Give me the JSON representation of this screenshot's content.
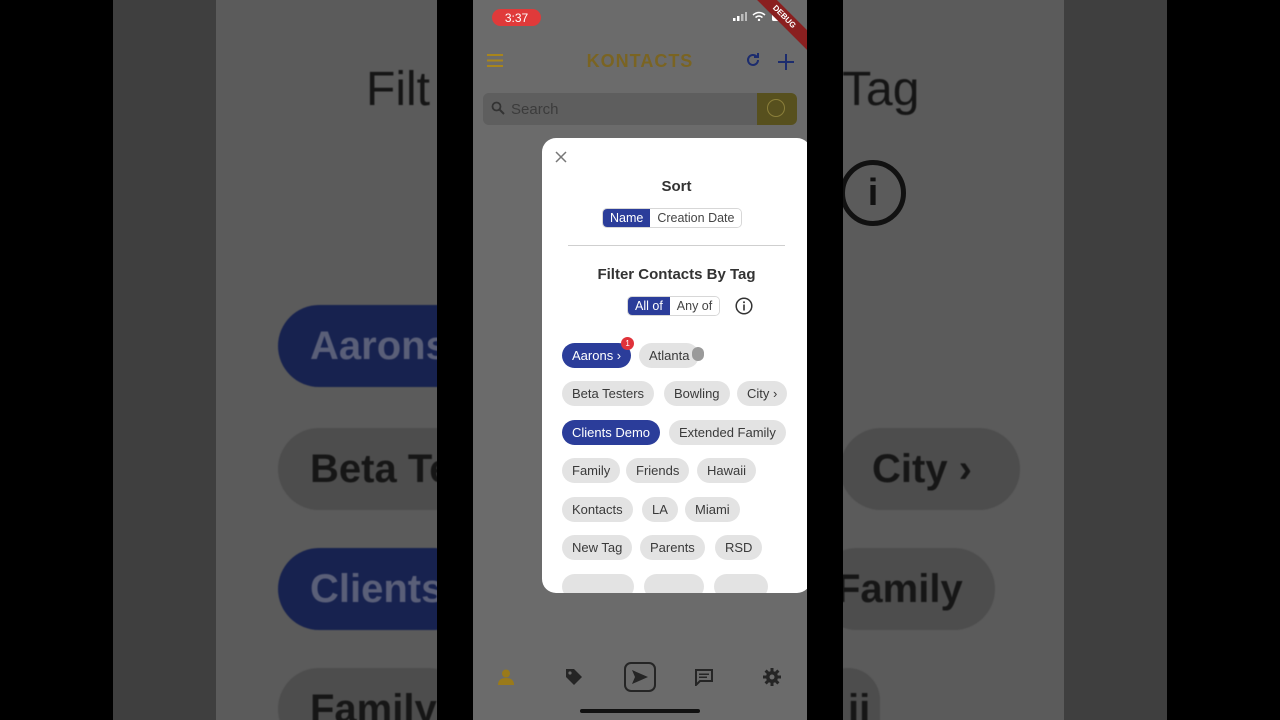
{
  "status_bar": {
    "time": "3:37",
    "debug_label": "DEBUG"
  },
  "app_bar": {
    "title": "KONTACTS"
  },
  "search": {
    "placeholder": "Search"
  },
  "sort_dialog": {
    "sort_title": "Sort",
    "sort_options": [
      "Name",
      "Creation Date"
    ],
    "sort_selected": "Name",
    "filter_title": "Filter Contacts By Tag",
    "match_options": [
      "All of",
      "Any of"
    ],
    "match_selected": "All of",
    "tags": [
      {
        "label": "Aarons ›",
        "selected": true,
        "badge": "1"
      },
      {
        "label": "Atlanta",
        "selected": false
      },
      {
        "label": "Beta Testers",
        "selected": false
      },
      {
        "label": "Bowling",
        "selected": false
      },
      {
        "label": "City ›",
        "selected": false
      },
      {
        "label": "Clients Demo",
        "selected": true
      },
      {
        "label": "Extended Family",
        "selected": false
      },
      {
        "label": "Family",
        "selected": false
      },
      {
        "label": "Friends",
        "selected": false
      },
      {
        "label": "Hawaii",
        "selected": false
      },
      {
        "label": "Kontacts",
        "selected": false
      },
      {
        "label": "LA",
        "selected": false
      },
      {
        "label": "Miami",
        "selected": false
      },
      {
        "label": "New Tag",
        "selected": false
      },
      {
        "label": "Parents",
        "selected": false
      },
      {
        "label": "RSD",
        "selected": false
      }
    ]
  },
  "bottom_nav": [
    "contacts-icon",
    "tags-icon",
    "send-icon",
    "messages-icon",
    "settings-icon"
  ],
  "background": {
    "title_fragment_left": "Filt",
    "title_fragment_right": "Tag",
    "chips": [
      "Aarons",
      "Beta Te",
      "City ›",
      "Clients",
      "Family",
      "Family",
      "ii"
    ]
  },
  "colors": {
    "accent": "#2b3d9a",
    "brand": "#9a7a1a",
    "badge": "#e0323a"
  }
}
